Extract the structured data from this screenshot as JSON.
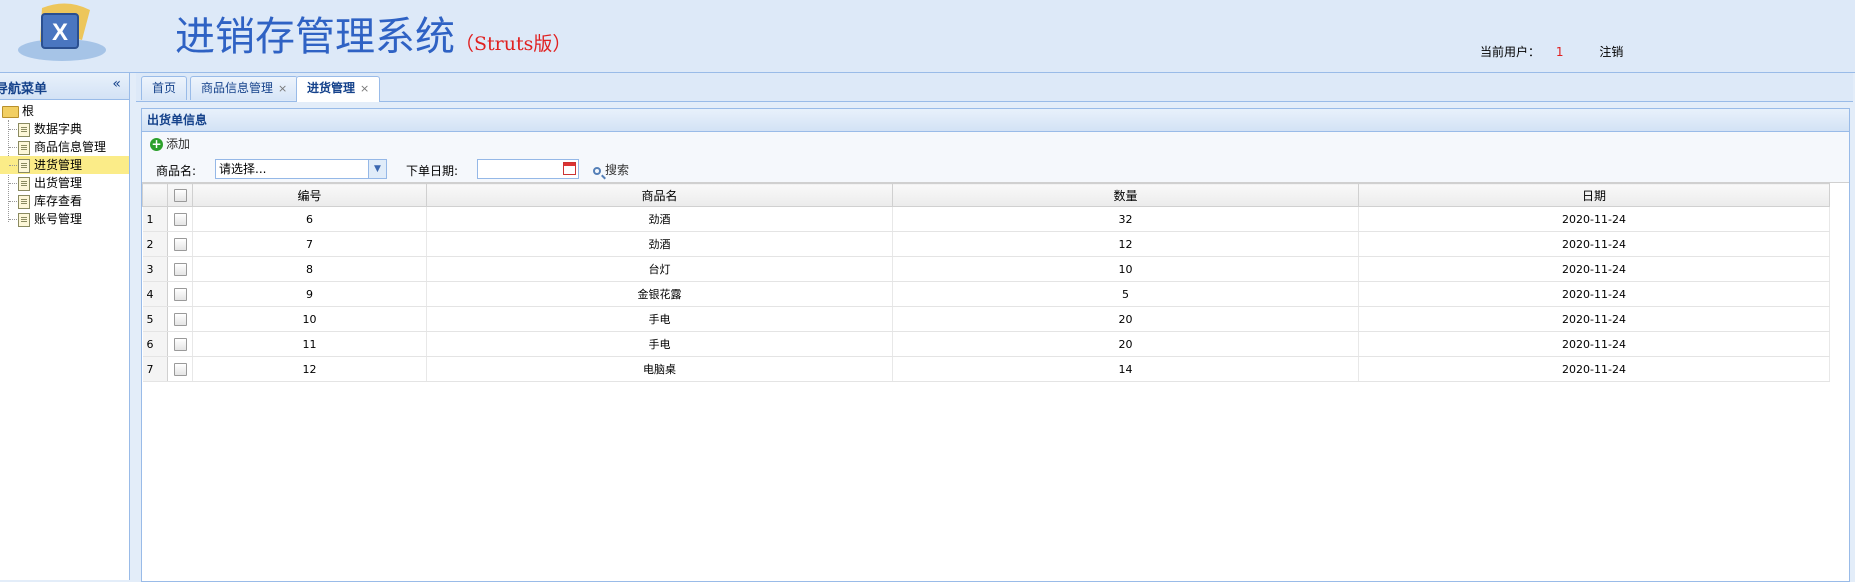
{
  "header": {
    "logo": "logo-icon",
    "title": "进销存管理系统",
    "edition": "（Struts版）",
    "current_user_label": "当前用户：",
    "current_user": "1",
    "logout": "注销",
    "colors": {
      "title": "#2f62c4",
      "edition": "#e02020",
      "user": "#e02020"
    }
  },
  "nav": {
    "title": "导航菜单",
    "collapse_icon": "double-chevron-left-icon",
    "root": "根",
    "items": [
      {
        "label": "数据字典",
        "selected": false
      },
      {
        "label": "商品信息管理",
        "selected": false
      },
      {
        "label": "进货管理",
        "selected": true
      },
      {
        "label": "出货管理",
        "selected": false
      },
      {
        "label": "库存查看",
        "selected": false
      },
      {
        "label": "账号管理",
        "selected": false
      }
    ]
  },
  "tabs": [
    {
      "label": "首页",
      "closable": false,
      "active": false
    },
    {
      "label": "商品信息管理",
      "closable": true,
      "active": false
    },
    {
      "label": "进货管理",
      "closable": true,
      "active": true
    }
  ],
  "panel": {
    "title": "出货单信息",
    "add_label": "添加",
    "product_filter_label": "商品名:",
    "product_filter_value": "请选择...",
    "date_filter_label": "下单日期:",
    "date_filter_value": "",
    "search_label": "搜索"
  },
  "grid": {
    "columns": [
      "编号",
      "商品名",
      "数量",
      "日期"
    ],
    "rows": [
      {
        "num": "1",
        "id": "6",
        "name": "劲酒",
        "qty": "32",
        "date": "2020-11-24"
      },
      {
        "num": "2",
        "id": "7",
        "name": "劲酒",
        "qty": "12",
        "date": "2020-11-24"
      },
      {
        "num": "3",
        "id": "8",
        "name": "台灯",
        "qty": "10",
        "date": "2020-11-24"
      },
      {
        "num": "4",
        "id": "9",
        "name": "金银花露",
        "qty": "5",
        "date": "2020-11-24"
      },
      {
        "num": "5",
        "id": "10",
        "name": "手电",
        "qty": "20",
        "date": "2020-11-24"
      },
      {
        "num": "6",
        "id": "11",
        "name": "手电",
        "qty": "20",
        "date": "2020-11-24"
      },
      {
        "num": "7",
        "id": "12",
        "name": "电脑桌",
        "qty": "14",
        "date": "2020-11-24"
      }
    ]
  }
}
